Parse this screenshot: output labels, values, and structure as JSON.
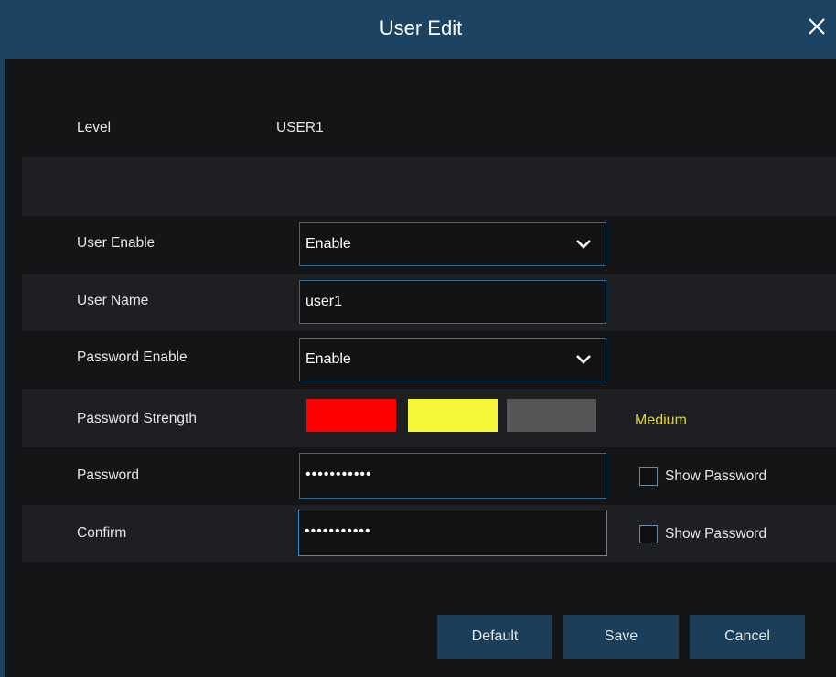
{
  "dialog": {
    "title": "User Edit",
    "close_icon": "close-icon"
  },
  "level": {
    "label": "Level",
    "value": "USER1"
  },
  "user_enable": {
    "label": "User Enable",
    "value": "Enable"
  },
  "user_name": {
    "label": "User Name",
    "value": "user1"
  },
  "password_enable": {
    "label": "Password Enable",
    "value": "Enable"
  },
  "password_strength": {
    "label": "Password Strength",
    "text": "Medium",
    "colors": [
      "#ff0000",
      "#f7f73a",
      "#555555"
    ]
  },
  "password": {
    "label": "Password",
    "masked_value": "•••••••••••",
    "show_label": "Show Password"
  },
  "confirm": {
    "label": "Confirm",
    "masked_value": "•••••••••••",
    "show_label": "Show Password"
  },
  "buttons": {
    "default": "Default",
    "save": "Save",
    "cancel": "Cancel"
  }
}
